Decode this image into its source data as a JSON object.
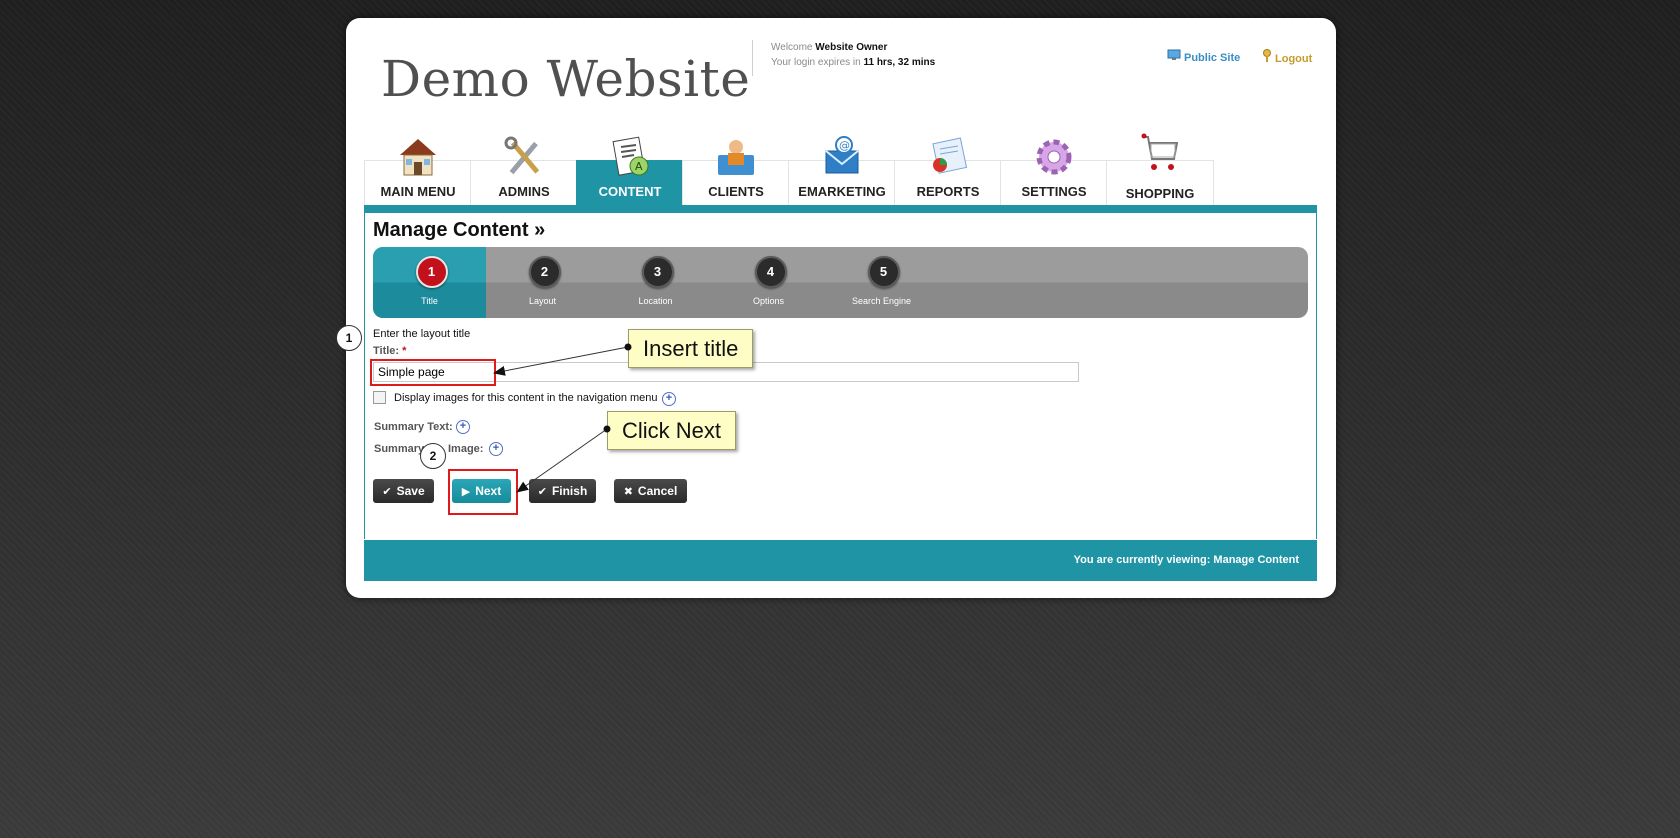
{
  "header": {
    "site_title": "Demo Website",
    "welcome_prefix": "Welcome",
    "user_name": "Website Owner",
    "expiry_prefix": "Your login expires in",
    "expiry_value": "11 hrs, 32 mins",
    "public_site_label": "Public Site",
    "logout_label": "Logout"
  },
  "tabs": [
    {
      "label": "MAIN MENU",
      "icon": "house-icon"
    },
    {
      "label": "ADMINS",
      "icon": "tools-icon"
    },
    {
      "label": "CONTENT",
      "icon": "document-icon"
    },
    {
      "label": "CLIENTS",
      "icon": "clients-icon"
    },
    {
      "label": "EMARKETING",
      "icon": "email-icon"
    },
    {
      "label": "REPORTS",
      "icon": "reports-icon"
    },
    {
      "label": "SETTINGS",
      "icon": "gear-icon"
    },
    {
      "label": "SHOPPING",
      "icon": "cart-icon"
    }
  ],
  "page": {
    "title": "Manage Content »"
  },
  "wizard": [
    {
      "number": "1",
      "label": "Title"
    },
    {
      "number": "2",
      "label": "Layout"
    },
    {
      "number": "3",
      "label": "Location"
    },
    {
      "number": "4",
      "label": "Options"
    },
    {
      "number": "5",
      "label": "Search Engine"
    }
  ],
  "form": {
    "instruction": "Enter the layout title",
    "title_label": "Title:",
    "required_mark": "*",
    "title_value": "Simple page",
    "display_images_label": "Display images for this content in the navigation menu",
    "summary_text_label": "Summary Text:",
    "summary_image_label_start": "Summary",
    "summary_image_label_end": "Image:"
  },
  "buttons": {
    "save": "Save",
    "next": "Next",
    "finish": "Finish",
    "cancel": "Cancel"
  },
  "footer": {
    "text": "You are currently viewing: Manage Content"
  },
  "annotations": {
    "callout_title": "Insert title",
    "callout_next": "Click Next",
    "marker_1": "1",
    "marker_2": "2"
  },
  "colors": {
    "teal": "#1e94a5",
    "active_step": "#c2111b",
    "highlight": "#e01a1a"
  }
}
